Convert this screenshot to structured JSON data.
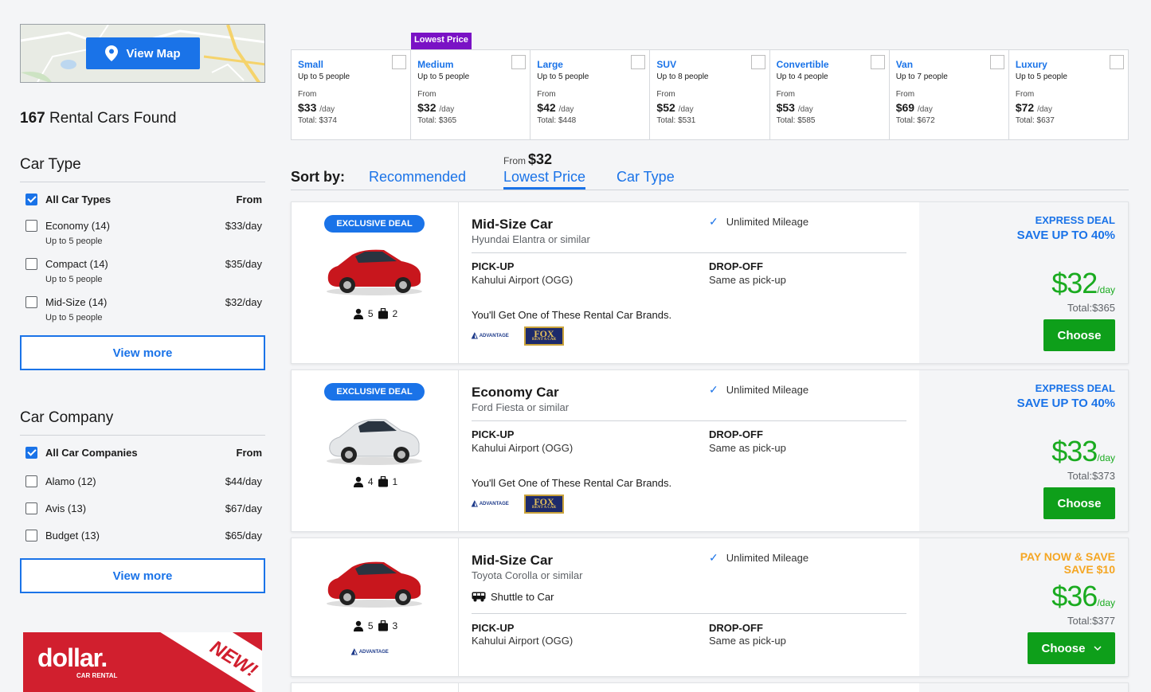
{
  "map": {
    "button_label": "View Map"
  },
  "results_count": "167",
  "results_label": "Rental Cars Found",
  "car_type_filter": {
    "title": "Car Type",
    "all_label": "All Car Types",
    "from_label": "From",
    "items": [
      {
        "label": "Economy (14)",
        "sub": "Up to 5 people",
        "price": "$33/day"
      },
      {
        "label": "Compact (14)",
        "sub": "Up to 5 people",
        "price": "$35/day"
      },
      {
        "label": "Mid-Size (14)",
        "sub": "Up to 5 people",
        "price": "$32/day"
      }
    ],
    "view_more": "View more"
  },
  "company_filter": {
    "title": "Car Company",
    "all_label": "All Car Companies",
    "from_label": "From",
    "items": [
      {
        "label": "Alamo (12)",
        "price": "$44/day"
      },
      {
        "label": "Avis (13)",
        "price": "$67/day"
      },
      {
        "label": "Budget (13)",
        "price": "$65/day"
      }
    ],
    "view_more": "View more"
  },
  "ad": {
    "logo": "dollar.",
    "sub": "CAR RENTAL",
    "badge": "NEW!"
  },
  "lowest_badge": "Lowest Price",
  "type_cards": [
    {
      "name": "Small",
      "cap": "Up to 5 people",
      "from": "From",
      "price": "$33",
      "unit": "/day",
      "total": "Total: $374"
    },
    {
      "name": "Medium",
      "cap": "Up to 5 people",
      "from": "From",
      "price": "$32",
      "unit": "/day",
      "total": "Total: $365"
    },
    {
      "name": "Large",
      "cap": "Up to 5 people",
      "from": "From",
      "price": "$42",
      "unit": "/day",
      "total": "Total: $448"
    },
    {
      "name": "SUV",
      "cap": "Up to 8 people",
      "from": "From",
      "price": "$52",
      "unit": "/day",
      "total": "Total: $531"
    },
    {
      "name": "Convertible",
      "cap": "Up to 4 people",
      "from": "From",
      "price": "$53",
      "unit": "/day",
      "total": "Total: $585"
    },
    {
      "name": "Van",
      "cap": "Up to 7 people",
      "from": "From",
      "price": "$69",
      "unit": "/day",
      "total": "Total: $672"
    },
    {
      "name": "Luxury",
      "cap": "Up to 5 people",
      "from": "From",
      "price": "$72",
      "unit": "/day",
      "total": "Total: $637"
    }
  ],
  "sort": {
    "label": "Sort by:",
    "options": [
      "Recommended",
      "Lowest Price",
      "Car Type"
    ],
    "from_label": "From",
    "from_price": "$32"
  },
  "results": [
    {
      "badge": "EXCLUSIVE DEAL",
      "name": "Mid-Size Car",
      "similar": "Hyundai Elantra or similar",
      "mileage": "Unlimited Mileage",
      "pickup_label": "PICK-UP",
      "pickup": "Kahului Airport (OGG)",
      "dropoff_label": "DROP-OFF",
      "dropoff": "Same as pick-up",
      "brands_text": "You'll Get One of These Rental Car Brands.",
      "people": "5",
      "bags": "2",
      "deal1": "EXPRESS DEAL",
      "deal2": "SAVE UP TO 40%",
      "price": "$32",
      "unit": "/day",
      "total": "Total:$365",
      "cta": "Choose",
      "color": "#c8161d"
    },
    {
      "badge": "EXCLUSIVE DEAL",
      "name": "Economy Car",
      "similar": "Ford Fiesta or similar",
      "mileage": "Unlimited Mileage",
      "pickup_label": "PICK-UP",
      "pickup": "Kahului Airport (OGG)",
      "dropoff_label": "DROP-OFF",
      "dropoff": "Same as pick-up",
      "brands_text": "You'll Get One of These Rental Car Brands.",
      "people": "4",
      "bags": "1",
      "deal1": "EXPRESS DEAL",
      "deal2": "SAVE UP TO 40%",
      "price": "$33",
      "unit": "/day",
      "total": "Total:$373",
      "cta": "Choose",
      "color": "#e4e6e8"
    },
    {
      "name": "Mid-Size Car",
      "similar": "Toyota Corolla or similar",
      "mileage": "Unlimited Mileage",
      "shuttle": "Shuttle to Car",
      "pickup_label": "PICK-UP",
      "pickup": "Kahului Airport (OGG)",
      "dropoff_label": "DROP-OFF",
      "dropoff": "Same as pick-up",
      "people": "5",
      "bags": "3",
      "deal1": "PAY NOW & SAVE",
      "deal2": "SAVE $10",
      "price": "$36",
      "unit": "/day",
      "total": "Total:$377",
      "cta": "Choose",
      "color": "#c8161d"
    }
  ],
  "brands": {
    "advantage": "ADVANTAGE",
    "fox": "FOX",
    "fox_sub": "RENT A CAR"
  },
  "colors": {
    "accent": "#1a73e8",
    "price_green": "#1aab20",
    "cta_green": "#0e9f1a",
    "badge_purple": "#7a12c5",
    "deal_orange": "#f5a623"
  }
}
